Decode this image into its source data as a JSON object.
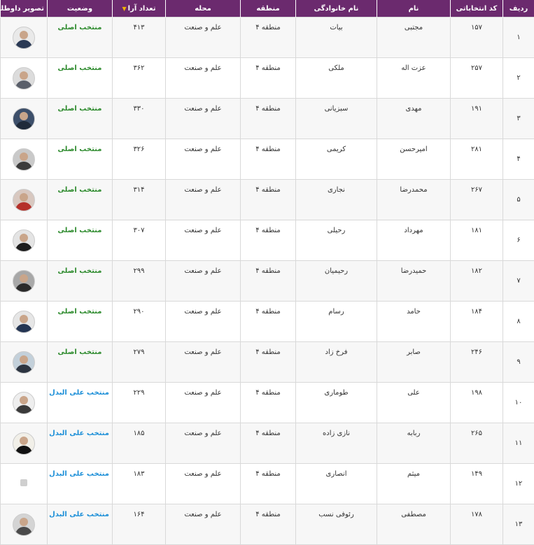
{
  "headers": {
    "row": "ردیف",
    "code": "کد انتخاباتی",
    "first_name": "نام",
    "last_name": "نام خانوادگی",
    "region": "منطقه",
    "location": "محله",
    "votes": "تعداد آرا",
    "status": "وضعیت",
    "photo": "تصویر داوطلب"
  },
  "rows": [
    {
      "num": "۱",
      "code": "۱۵۷",
      "first": "مجتبی",
      "last": "بیات",
      "region": "منطقه ۴",
      "location": "علم و صنعت",
      "votes": "۴۱۳",
      "status": "منتخب اصلی",
      "type": "main",
      "avatar_bg": "#e9e9e9",
      "avatar_fg": "#2b3a55"
    },
    {
      "num": "۲",
      "code": "۲۵۷",
      "first": "عزت اله",
      "last": "ملکی",
      "region": "منطقه ۴",
      "location": "علم و صنعت",
      "votes": "۳۶۲",
      "status": "منتخب اصلی",
      "type": "main",
      "avatar_bg": "#dcdcdc",
      "avatar_fg": "#5a5f6a"
    },
    {
      "num": "۳",
      "code": "۱۹۱",
      "first": "مهدی",
      "last": "سبزیانی",
      "region": "منطقه ۴",
      "location": "علم و صنعت",
      "votes": "۳۳۰",
      "status": "منتخب اصلی",
      "type": "main",
      "avatar_bg": "#3d4f6a",
      "avatar_fg": "#1f2a3a"
    },
    {
      "num": "۴",
      "code": "۲۸۱",
      "first": "امیرحسن",
      "last": "کریمی",
      "region": "منطقه ۴",
      "location": "علم و صنعت",
      "votes": "۳۲۶",
      "status": "منتخب اصلی",
      "type": "main",
      "avatar_bg": "#c9c9c9",
      "avatar_fg": "#3b3b3b"
    },
    {
      "num": "۵",
      "code": "۲۶۷",
      "first": "محمدرضا",
      "last": "نجاری",
      "region": "منطقه ۴",
      "location": "علم و صنعت",
      "votes": "۳۱۴",
      "status": "منتخب اصلی",
      "type": "main",
      "avatar_bg": "#d8c8c0",
      "avatar_fg": "#b5302a"
    },
    {
      "num": "۶",
      "code": "۱۸۱",
      "first": "مهرداد",
      "last": "رحیلی",
      "region": "منطقه ۴",
      "location": "علم و صنعت",
      "votes": "۳۰۷",
      "status": "منتخب اصلی",
      "type": "main",
      "avatar_bg": "#e4e4e4",
      "avatar_fg": "#1d1d1d"
    },
    {
      "num": "۷",
      "code": "۱۸۲",
      "first": "حمیدرضا",
      "last": "رحیمیان",
      "region": "منطقه ۴",
      "location": "علم و صنعت",
      "votes": "۲۹۹",
      "status": "منتخب اصلی",
      "type": "main",
      "avatar_bg": "#a8a8a8",
      "avatar_fg": "#2a2a2a"
    },
    {
      "num": "۸",
      "code": "۱۸۴",
      "first": "حامد",
      "last": "رسام",
      "region": "منطقه ۴",
      "location": "علم و صنعت",
      "votes": "۲۹۰",
      "status": "منتخب اصلی",
      "type": "main",
      "avatar_bg": "#e6e6e6",
      "avatar_fg": "#243552"
    },
    {
      "num": "۹",
      "code": "۲۴۶",
      "first": "صابر",
      "last": "فرخ زاد",
      "region": "منطقه ۴",
      "location": "علم و صنعت",
      "votes": "۲۷۹",
      "status": "منتخب اصلی",
      "type": "main",
      "avatar_bg": "#c3d0da",
      "avatar_fg": "#2c3440"
    },
    {
      "num": "۱۰",
      "code": "۱۹۸",
      "first": "علی",
      "last": "طوماری",
      "region": "منطقه ۴",
      "location": "علم و صنعت",
      "votes": "۲۲۹",
      "status": "منتخب علی البدل",
      "type": "alt",
      "avatar_bg": "#eeeeee",
      "avatar_fg": "#3a3a3a"
    },
    {
      "num": "۱۱",
      "code": "۲۶۵",
      "first": "ربابه",
      "last": "نازی زاده",
      "region": "منطقه ۴",
      "location": "علم و صنعت",
      "votes": "۱۸۵",
      "status": "منتخب علی البدل",
      "type": "alt",
      "avatar_bg": "#f1efe8",
      "avatar_fg": "#111111"
    },
    {
      "num": "۱۲",
      "code": "۱۴۹",
      "first": "میثم",
      "last": "انصاری",
      "region": "منطقه ۴",
      "location": "علم و صنعت",
      "votes": "۱۸۳",
      "status": "منتخب علی البدل",
      "type": "alt",
      "avatar_bg": "#ffffff",
      "avatar_fg": "#cfcfcf",
      "placeholder": true
    },
    {
      "num": "۱۳",
      "code": "۱۷۸",
      "first": "مصطفی",
      "last": "رئوفی نسب",
      "region": "منطقه ۴",
      "location": "علم و صنعت",
      "votes": "۱۶۴",
      "status": "منتخب علی البدل",
      "type": "alt",
      "avatar_bg": "#d4d4d4",
      "avatar_fg": "#4a4a4a"
    }
  ]
}
